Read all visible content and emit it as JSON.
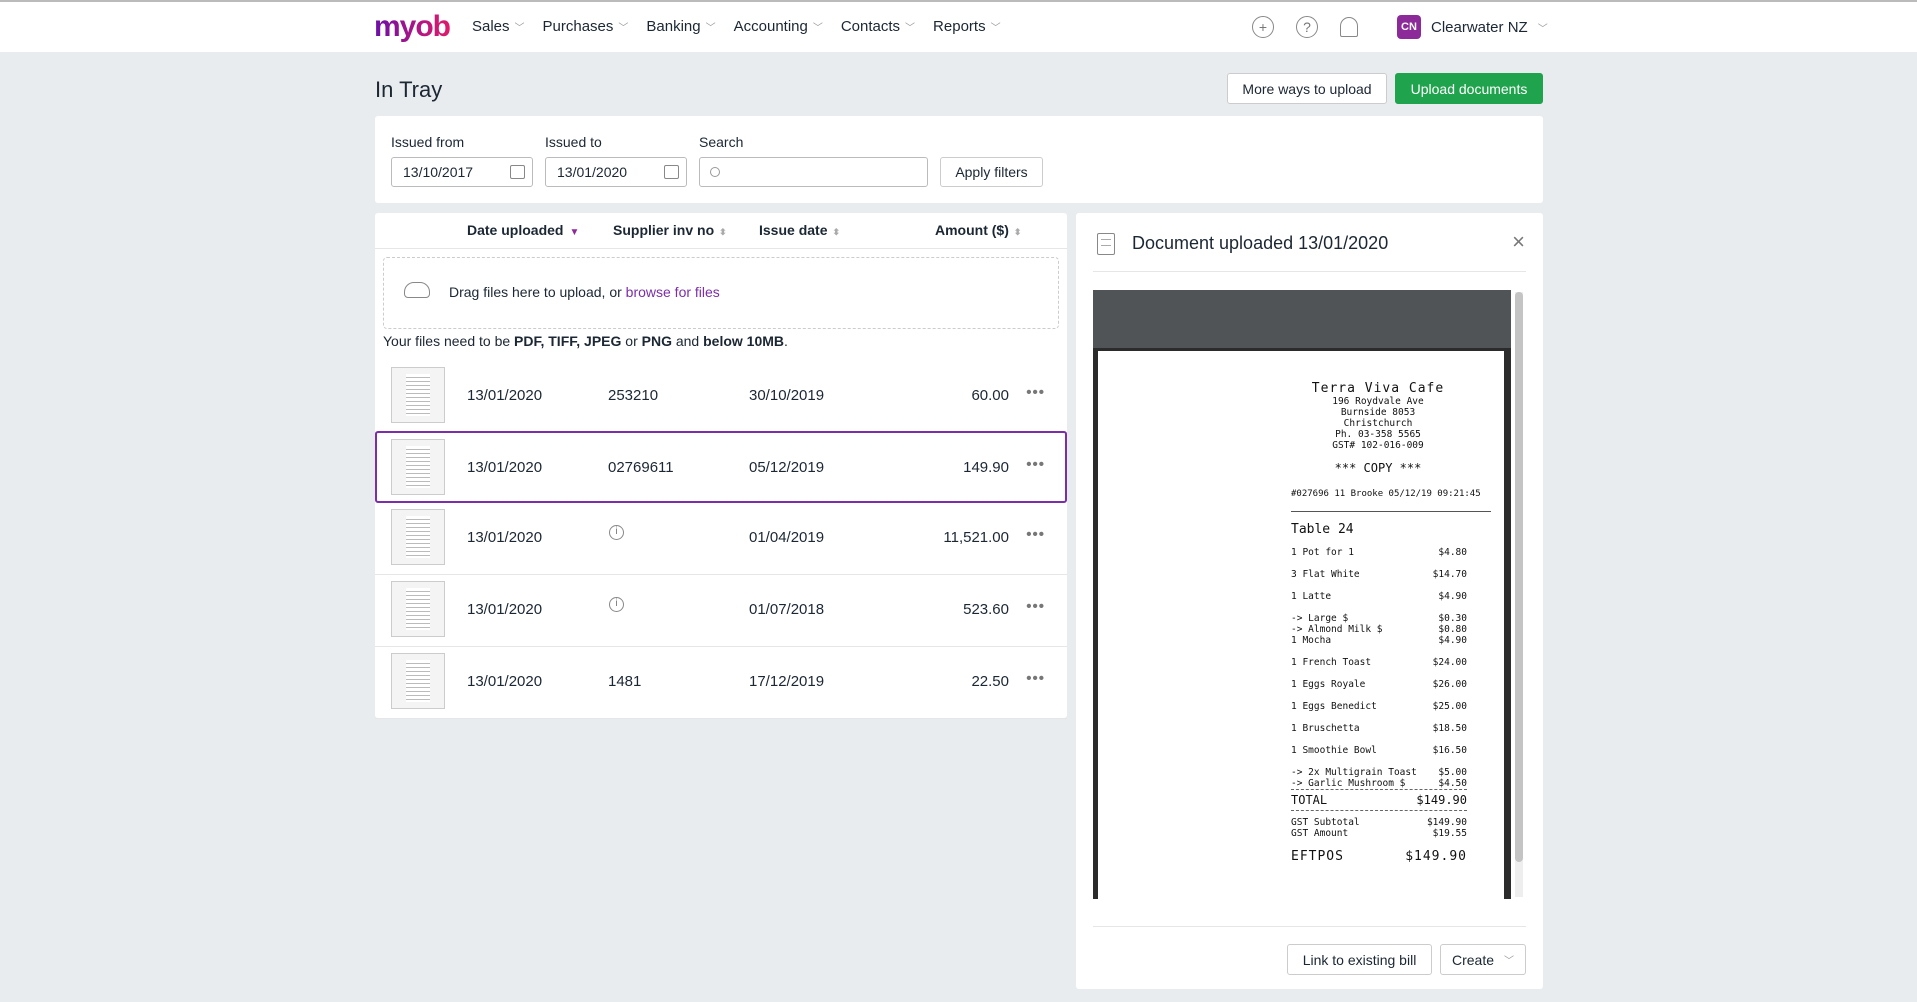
{
  "nav": {
    "logo": "myob",
    "items": [
      "Sales",
      "Purchases",
      "Banking",
      "Accounting",
      "Contacts",
      "Reports"
    ],
    "business_initials": "CN",
    "business_name": "Clearwater NZ"
  },
  "page": {
    "title": "In Tray",
    "more_ways": "More ways to upload",
    "upload": "Upload documents"
  },
  "filters": {
    "from_label": "Issued from",
    "from_value": "13/10/2017",
    "to_label": "Issued to",
    "to_value": "13/01/2020",
    "search_label": "Search",
    "search_value": "",
    "apply": "Apply filters"
  },
  "table": {
    "headers": [
      "Date uploaded",
      "Supplier inv no",
      "Issue date",
      "Amount ($)"
    ],
    "drop_text": "Drag files here to upload, or ",
    "drop_link": "browse for files",
    "req_1": "Your files need to be ",
    "req_2": "PDF, TIFF, JPEG",
    "req_3": " or ",
    "req_4": "PNG",
    "req_5": " and ",
    "req_6": "below 10MB",
    ".": ".",
    "rows": [
      {
        "date": "13/01/2020",
        "inv": "253210",
        "issue": "30/10/2019",
        "amount": "60.00"
      },
      {
        "date": "13/01/2020",
        "inv": "02769611",
        "issue": "05/12/2019",
        "amount": "149.90"
      },
      {
        "date": "13/01/2020",
        "inv": "",
        "issue": "01/04/2019",
        "amount": "11,521.00"
      },
      {
        "date": "13/01/2020",
        "inv": "",
        "issue": "01/07/2018",
        "amount": "523.60"
      },
      {
        "date": "13/01/2020",
        "inv": "1481",
        "issue": "17/12/2019",
        "amount": "22.50"
      }
    ]
  },
  "panel": {
    "title": "Document uploaded 13/01/2020",
    "link": "Link to existing bill",
    "create": "Create"
  },
  "receipt": {
    "name": "Terra Viva Cafe",
    "addr": [
      "196 Roydvale Ave",
      "Burnside 8053",
      "Christchurch",
      "Ph. 03-358 5565",
      "GST# 102-016-009"
    ],
    "copy": "*** COPY ***",
    "ref": "#027696 11 Brooke 05/12/19 09:21:45",
    "table": "Table 24",
    "items": [
      [
        "1 Pot for 1",
        "$4.80"
      ],
      [
        "3 Flat White",
        "$14.70"
      ],
      [
        "1 Latte",
        "$4.90"
      ],
      [
        "-> Large $",
        "$0.30"
      ],
      [
        "-> Almond Milk $",
        "$0.80"
      ],
      [
        "1 Mocha",
        "$4.90"
      ],
      [
        "1 French Toast",
        "$24.00"
      ],
      [
        "1 Eggs Royale",
        "$26.00"
      ],
      [
        "1 Eggs Benedict",
        "$25.00"
      ],
      [
        "1 Bruschetta",
        "$18.50"
      ],
      [
        "1 Smoothie Bowl",
        "$16.50"
      ],
      [
        "-> 2x Multigrain Toast",
        "$5.00"
      ],
      [
        "-> Garlic Mushroom $",
        "$4.50"
      ]
    ],
    "total_label": "TOTAL",
    "total": "$149.90",
    "gst_sub_label": "GST Subtotal",
    "gst_sub": "$149.90",
    "gst_amt_label": "GST Amount",
    "gst_amt": "$19.55",
    "eftpos_label": "EFTPOS",
    "eftpos": "$149.90"
  }
}
